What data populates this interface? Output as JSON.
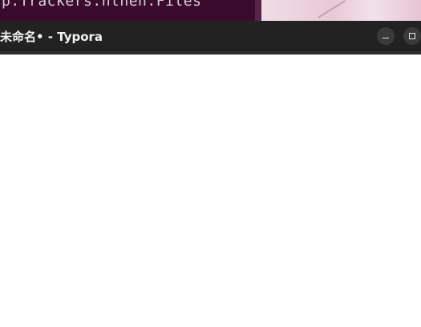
{
  "background": {
    "terminal_text": "p.Trackers.nthen.Files",
    "terminal_color": "#3b0b2e"
  },
  "window": {
    "title": "未命名• - Typora",
    "titlebar_color": "#222222",
    "menubar_color": "#2b2b2b",
    "controls": {
      "minimize_icon": "minimize-icon",
      "maximize_icon": "maximize-icon"
    }
  },
  "editor": {
    "content": ""
  }
}
